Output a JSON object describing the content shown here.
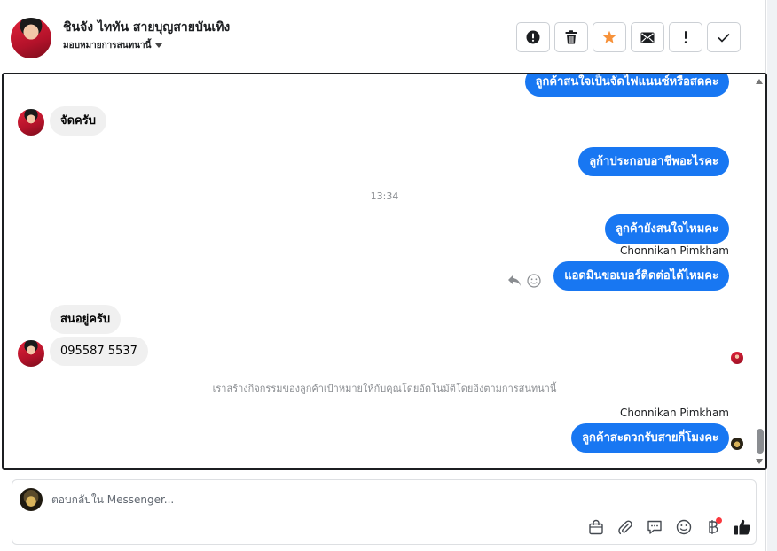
{
  "header": {
    "contact_name": "ชินจัง ไททัน สายบุญสายบันเทิง",
    "assign_label": "มอบหมายการสนทนานี้",
    "toolbar": [
      {
        "name": "report-spam-button",
        "icon": "alert-circle-icon"
      },
      {
        "name": "delete-button",
        "icon": "trash-icon"
      },
      {
        "name": "star-button",
        "icon": "star-icon"
      },
      {
        "name": "mark-unread-button",
        "icon": "envelope-icon"
      },
      {
        "name": "follow-up-button",
        "icon": "exclamation-icon"
      },
      {
        "name": "mark-done-button",
        "icon": "check-icon"
      }
    ]
  },
  "colors": {
    "outgoing_bubble": "#1877f2",
    "incoming_bubble": "#f0f0f0",
    "star": "#f7923a"
  },
  "conversation": {
    "messages": [
      {
        "id": "m1",
        "direction": "out",
        "text": "ลูกค้าสนใจเป็นจัดไฟแนนซ์หรือสดคะ"
      },
      {
        "id": "m2",
        "direction": "in",
        "text": "จัดครับ"
      },
      {
        "id": "m3",
        "direction": "out",
        "text": "ลูก้าประกอบอาชีพอะไรคะ"
      },
      {
        "id": "m4",
        "direction": "out",
        "text": "ลูกค้ายังสนใจไหมคะ"
      },
      {
        "id": "m5",
        "direction": "out",
        "text": "แอดมินขอเบอร์ติดต่อได้ไหมคะ",
        "sender": "Chonnikan Pimkham"
      },
      {
        "id": "m6",
        "direction": "in",
        "text": "สนอยู่ครับ"
      },
      {
        "id": "m7",
        "direction": "in",
        "text": "095587 5537"
      },
      {
        "id": "m8",
        "direction": "out",
        "text": "ลูกค้าสะดวกรับสายกี่โมงคะ",
        "sender": "Chonnikan Pimkham"
      }
    ],
    "timestamp": "13:34",
    "system_note": "เราสร้างกิจกรรมของลูกค้าเป้าหมายให้กับคุณโดยอัตโนมัติโดยอิงตามการสนทนานี้"
  },
  "composer": {
    "placeholder": "ตอบกลับใน Messenger..."
  }
}
